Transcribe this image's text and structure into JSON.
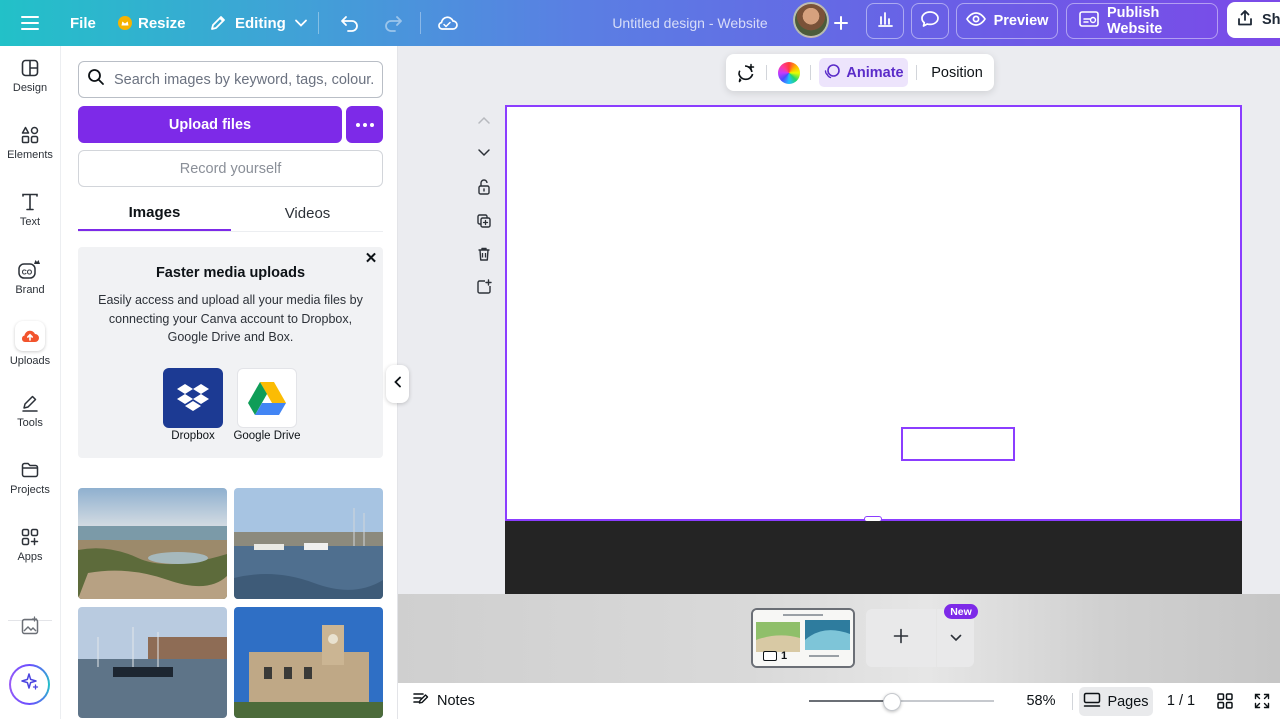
{
  "topbar": {
    "file_label": "File",
    "resize_label": "Resize",
    "editing_label": "Editing",
    "doc_title": "Untitled design - Website",
    "preview_label": "Preview",
    "publish_label": "Publish Website",
    "share_label": "Sh"
  },
  "rail": {
    "items": [
      {
        "label": "Design",
        "icon": "design-icon"
      },
      {
        "label": "Elements",
        "icon": "elements-icon"
      },
      {
        "label": "Text",
        "icon": "text-icon"
      },
      {
        "label": "Brand",
        "icon": "brand-icon"
      },
      {
        "label": "Uploads",
        "icon": "uploads-icon"
      },
      {
        "label": "Tools",
        "icon": "tools-icon"
      },
      {
        "label": "Projects",
        "icon": "projects-icon"
      },
      {
        "label": "Apps",
        "icon": "apps-icon"
      }
    ]
  },
  "panel": {
    "search_placeholder": "Search images by keyword, tags, colour...",
    "upload_label": "Upload files",
    "record_label": "Record yourself",
    "tabs": [
      {
        "label": "Images",
        "active": true
      },
      {
        "label": "Videos",
        "active": false
      }
    ],
    "promo": {
      "title": "Faster media uploads",
      "body": "Easily access and upload all your media files by connecting your Canva account to Dropbox, Google Drive and Box.",
      "services": [
        {
          "label": "Dropbox",
          "icon": "dropbox-icon"
        },
        {
          "label": "Google Drive",
          "icon": "google-drive-icon"
        }
      ]
    },
    "images": [
      {
        "name": "rocky-beach-photo"
      },
      {
        "name": "harbour-boats-photo"
      },
      {
        "name": "marina-boats-photo"
      },
      {
        "name": "clock-tower-building-photo"
      }
    ]
  },
  "context_toolbar": {
    "animate_label": "Animate",
    "position_label": "Position"
  },
  "pages": {
    "current_page": "1",
    "new_badge": "New"
  },
  "bottombar": {
    "notes_label": "Notes",
    "zoom_label": "58%",
    "zoom_fraction": 0.45,
    "pages_label": "Pages",
    "page_count": "1 / 1"
  },
  "colors": {
    "accent": "#7d2ae8",
    "selection": "#8b3dff"
  }
}
